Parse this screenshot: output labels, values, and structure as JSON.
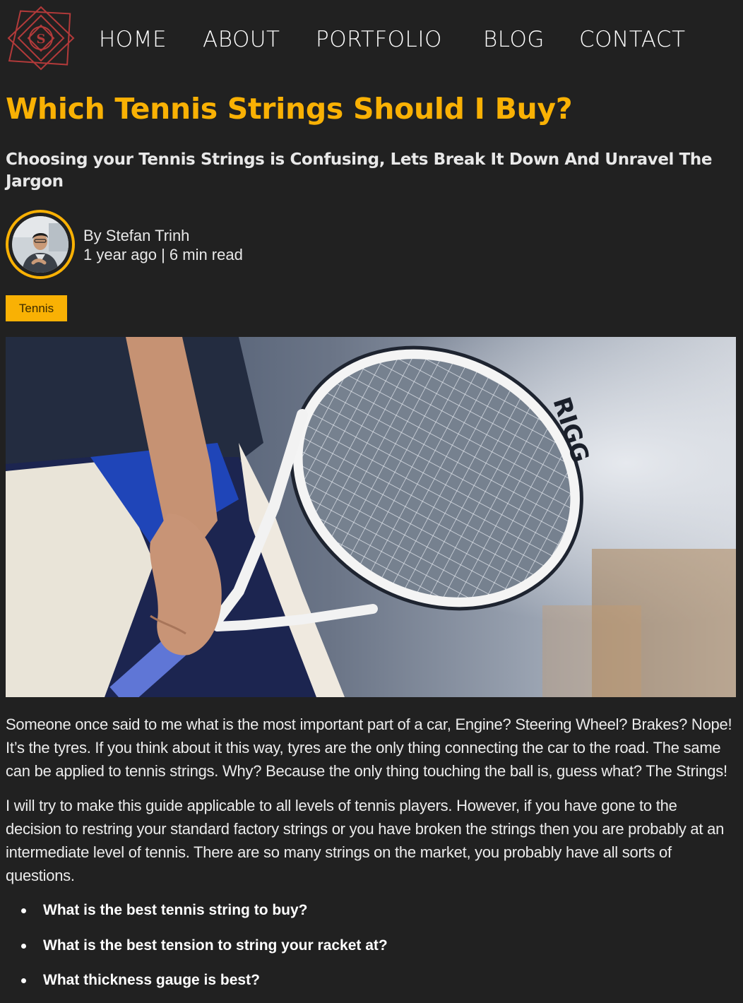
{
  "nav": {
    "items": [
      "HOME",
      "ABOUT",
      "PORTFOLIO",
      "BLOG",
      "CONTACT"
    ],
    "logo": "geometric-diamond-logo"
  },
  "article": {
    "title": "Which Tennis Strings Should I Buy?",
    "subtitle": "Choosing your Tennis Strings is Confusing, Lets Break It Down And Unravel The Jargon",
    "author_line": "By Stefan Trinh",
    "meta_line": "1 year ago | 6 min read",
    "tag": "Tennis",
    "hero_image": "tennis player holding a racket by the grip",
    "paragraphs": [
      "Someone once said to me what is the most important part of a car, Engine? Steering Wheel? Brakes? Nope! It’s the tyres. If you think about it this way, tyres are the only thing connecting the car to the road. The same can be applied to tennis strings. Why? Because the only thing touching the ball is, guess what? The Strings!",
      "I will try to make this guide applicable to all levels of tennis players. However, if you have gone to the decision to restring your standard factory strings or you have broken the strings then you are probably at an intermediate level of tennis. There are so many strings on the market, you probably have all sorts of questions."
    ],
    "questions": [
      "What is the best tennis string to buy?",
      "What is the best tension to string your racket at?",
      "What thickness gauge is best?"
    ]
  },
  "colors": {
    "background": "#212121",
    "accent": "#f9b104",
    "text": "#ececec",
    "logo": "#b23a3a"
  }
}
